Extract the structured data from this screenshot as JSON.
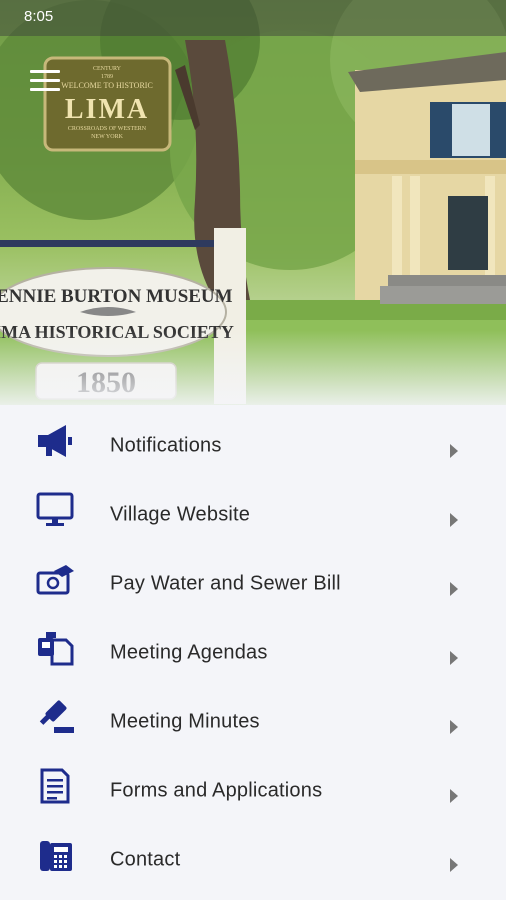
{
  "status_bar": {
    "time": "8:05"
  },
  "hero": {
    "sign_top_small": "CENTURY",
    "sign_year_small": "1789",
    "sign_top": "WELCOME TO HISTORIC",
    "sign_town": "LIMA",
    "sign_bottom": "CROSSROADS OF WESTERN",
    "sign_state": "NEW YORK",
    "museum_line1": "TENNIE BURTON MUSEUM",
    "museum_line2": "LIMA HISTORICAL SOCIETY",
    "museum_year": "1850"
  },
  "menu": {
    "accent_color": "#1e2c8c",
    "items": [
      {
        "label": "Notifications",
        "icon": "megaphone-icon"
      },
      {
        "label": "Village Website",
        "icon": "monitor-icon"
      },
      {
        "label": "Pay Water and Sewer Bill",
        "icon": "bill-payment-icon"
      },
      {
        "label": "Meeting Agendas",
        "icon": "agenda-documents-icon"
      },
      {
        "label": "Meeting Minutes",
        "icon": "gavel-icon"
      },
      {
        "label": "Forms and Applications",
        "icon": "form-document-icon"
      },
      {
        "label": "Contact",
        "icon": "phone-icon"
      }
    ]
  }
}
